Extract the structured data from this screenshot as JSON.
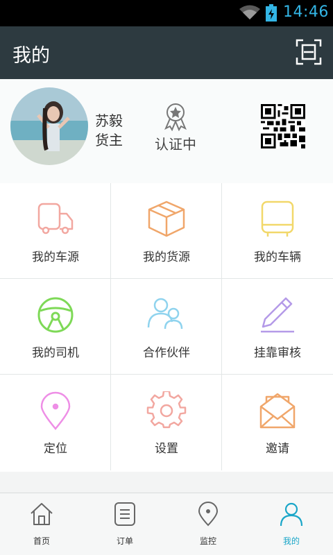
{
  "status_bar": {
    "time": "14:46",
    "time_color": "#33b5e5"
  },
  "app_bar": {
    "title": "我的",
    "background": "#2d3a40",
    "scan_icon": "scan-frame-icon"
  },
  "profile": {
    "name": "苏毅",
    "role": "货主",
    "certification_status": "认证中",
    "certification_icon": "award-ribbon-icon",
    "qr_icon": "qr-code-icon"
  },
  "menu": [
    {
      "label": "我的车源",
      "icon": "truck-icon",
      "color": "#f2a7a0"
    },
    {
      "label": "我的货源",
      "icon": "package-box-icon",
      "color": "#f0a66a"
    },
    {
      "label": "我的车辆",
      "icon": "bus-icon",
      "color": "#f2d86a"
    },
    {
      "label": "我的司机",
      "icon": "steering-wheel-icon",
      "color": "#7ed957"
    },
    {
      "label": "合作伙伴",
      "icon": "partners-icon",
      "color": "#8fd3ee"
    },
    {
      "label": "挂靠审核",
      "icon": "edit-pencil-icon",
      "color": "#b49ae8"
    },
    {
      "label": "定位",
      "icon": "location-pin-icon",
      "color": "#ee8ee6"
    },
    {
      "label": "设置",
      "icon": "gear-icon",
      "color": "#f2a7a0"
    },
    {
      "label": "邀请",
      "icon": "envelope-icon",
      "color": "#f0a66a"
    }
  ],
  "bottom_nav": [
    {
      "label": "首页",
      "icon": "home-icon",
      "active": false
    },
    {
      "label": "订单",
      "icon": "order-list-icon",
      "active": false
    },
    {
      "label": "监控",
      "icon": "map-pin-icon",
      "active": false
    },
    {
      "label": "我的",
      "icon": "person-icon",
      "active": true
    }
  ],
  "accent_color": "#1aa6c8"
}
